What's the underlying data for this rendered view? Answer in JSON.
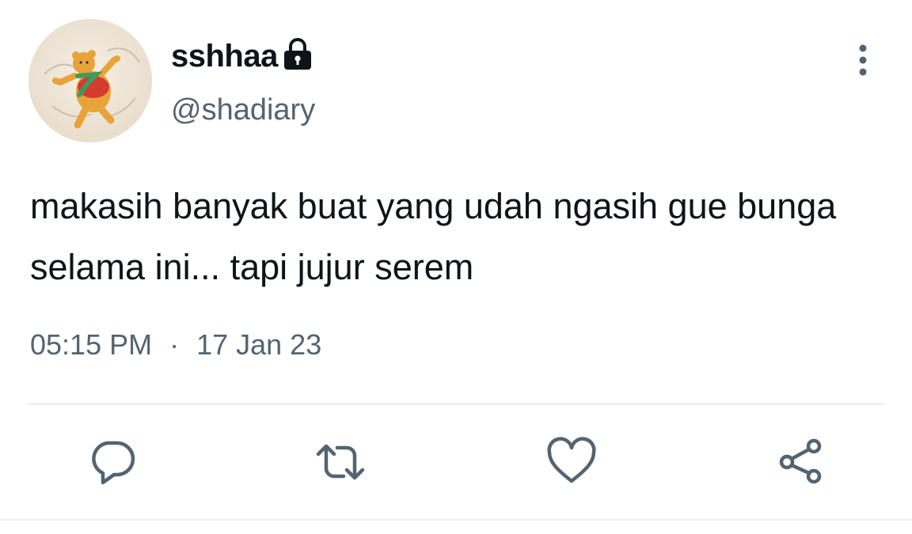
{
  "user": {
    "display_name": "sshhaa",
    "handle": "@shadiary",
    "avatar_icon": "avatar-image",
    "protected_icon": "lock-icon"
  },
  "tweet": {
    "text": "makasih banyak buat yang udah ngasih gue bunga selama ini... tapi jujur serem",
    "time": "05:15 PM",
    "separator": "·",
    "date": "17 Jan 23"
  },
  "actions": {
    "reply_icon": "reply-icon",
    "retweet_icon": "retweet-icon",
    "like_icon": "heart-icon",
    "share_icon": "share-icon",
    "more_icon": "more-options-icon"
  },
  "colors": {
    "text_primary": "#0f1419",
    "text_secondary": "#536471",
    "divider": "#e7e9ea"
  }
}
